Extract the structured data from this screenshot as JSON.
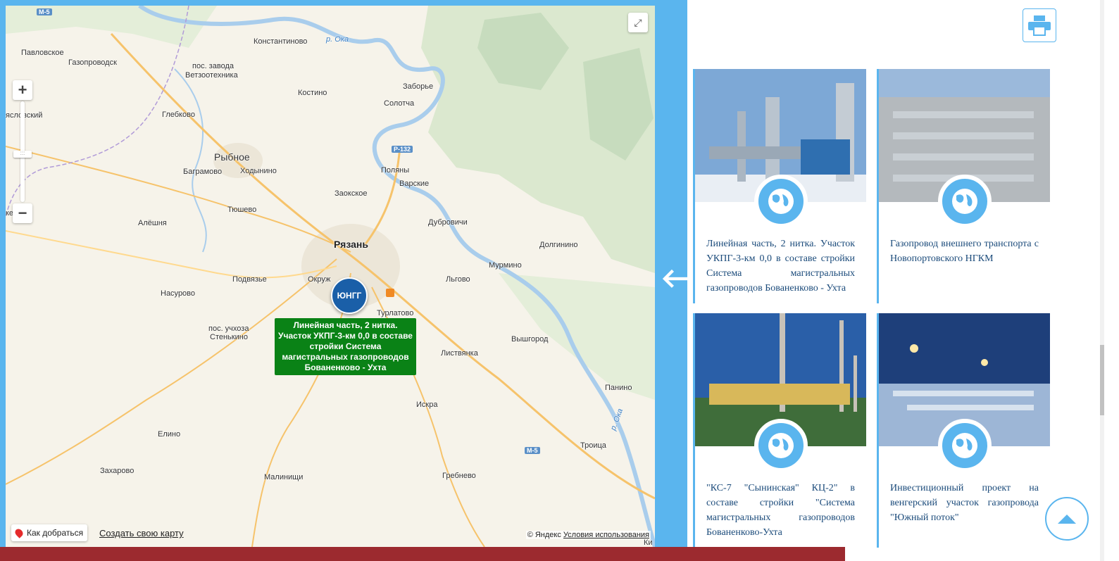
{
  "map": {
    "places": [
      {
        "name": "Константиново"
      },
      {
        "name": "Павловское"
      },
      {
        "name": "Газопроводск"
      },
      {
        "name": "пос. завода"
      },
      {
        "name": "Ветзоотехника"
      },
      {
        "name": "Костино"
      },
      {
        "name": "Заборье"
      },
      {
        "name": "Солотча"
      },
      {
        "name": "Глебково"
      },
      {
        "name": "Рыбное"
      },
      {
        "name": "Багрaмово"
      },
      {
        "name": "Ходынино"
      },
      {
        "name": "Поляны"
      },
      {
        "name": "Варские"
      },
      {
        "name": "Заокское"
      },
      {
        "name": "Тюшево"
      },
      {
        "name": "Алёшня"
      },
      {
        "name": "Дубровичи"
      },
      {
        "name": "Рязань"
      },
      {
        "name": "Долгинино"
      },
      {
        "name": "Мурмино"
      },
      {
        "name": "Подвязье"
      },
      {
        "name": "Льгово"
      },
      {
        "name": "Насурово"
      },
      {
        "name": "Турлатово"
      },
      {
        "name": "пос. учхоза"
      },
      {
        "name": "Стенькино"
      },
      {
        "name": "Вышгород"
      },
      {
        "name": "Листвянка"
      },
      {
        "name": "Панино"
      },
      {
        "name": "Искра"
      },
      {
        "name": "Елино"
      },
      {
        "name": "Троица"
      },
      {
        "name": "Захарово"
      },
      {
        "name": "Гребнево"
      },
      {
        "name": "Малинищи"
      },
      {
        "name": "ясловский"
      },
      {
        "name": "кеево"
      },
      {
        "name": "Окруж"
      },
      {
        "name": "Ки"
      }
    ],
    "rivers": [
      "р. Ока",
      "р. Ока"
    ],
    "roads": [
      "М-5",
      "Р-132",
      "М-5"
    ],
    "marker_label": "ЮНГГ",
    "tooltip": "Линейная часть, 2 нитка. Участок УКПГ-3-км 0,0 в составе стройки Система магистральных газопроводов Бованенково - Ухта",
    "route_button": "Как добраться",
    "create_map_link": "Создать свою карту",
    "copyright_prefix": "© Яндекс",
    "terms_link": "Условия использования"
  },
  "projects": [
    {
      "title": "Линейная часть, 2 нитка. Участок УКПГ-3-км 0,0 в составе стройки Система магистральных газопроводов Бованенково - Ухта"
    },
    {
      "title": "Газопровод внешнего транспорта с Новопортовского НГКМ"
    },
    {
      "title": "\"КС-7 \"Сынинская\" КЦ-2\" в составе стройки \"Система магистральных газопроводов Бованенково-Ухта"
    },
    {
      "title": "Инвестиционный проект на венгерский участок газопровода \"Южный поток\""
    }
  ],
  "colors": {
    "accent": "#5ab5ee",
    "tooltip": "#0a8216",
    "marker": "#1a5fa8",
    "footer": "#9c2a2f"
  }
}
